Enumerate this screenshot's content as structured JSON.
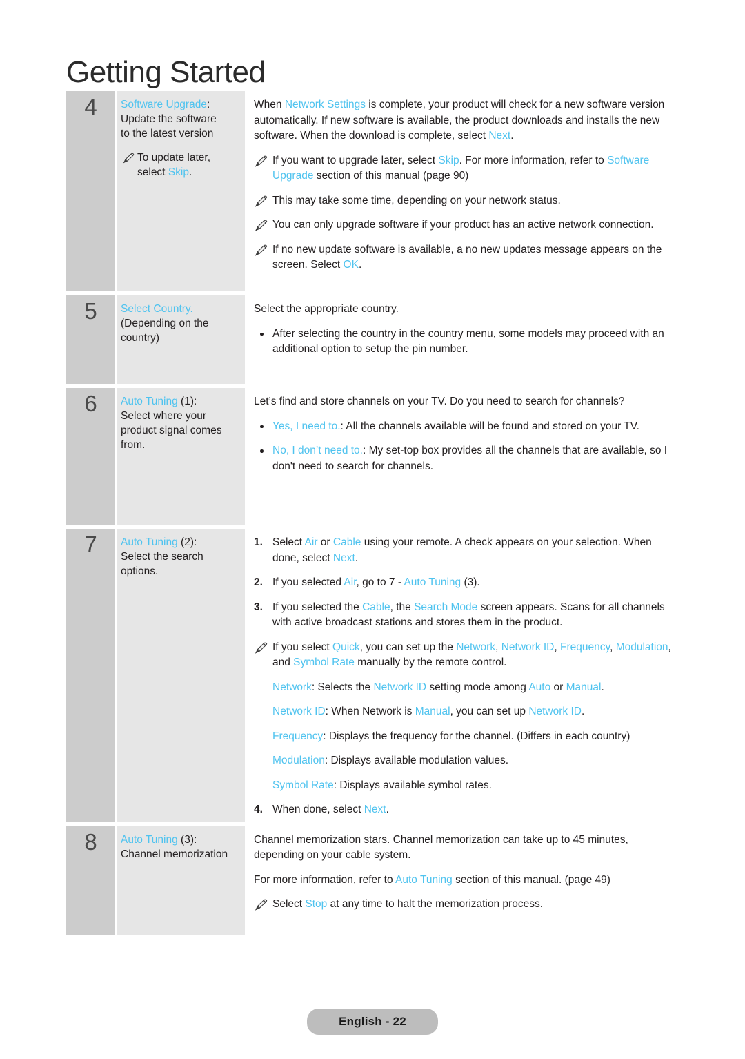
{
  "page": {
    "title": "Getting Started",
    "footer_label": "English - 22",
    "accent_color": "#4fc3ef",
    "number_column_color": "#cccccc",
    "label_column_color": "#e6e6e6"
  },
  "steps": [
    {
      "number": "4",
      "label": {
        "title_accent": "Software Upgrade",
        "title_tail": ":",
        "desc_line1": "Update the software",
        "desc_line2": "to the latest version",
        "note": {
          "icon": "pencil-icon",
          "text_1": "To update later,",
          "text_2": "select ",
          "accent": "Skip",
          "text_3": "."
        }
      },
      "body": [
        {
          "kind": "para",
          "runs": [
            {
              "t": "When "
            },
            {
              "t": "Network Settings",
              "a": true
            },
            {
              "t": " is complete, your product will check for a new software version automatically. If new software is available, the product downloads and installs the new software. When the download is complete, select "
            },
            {
              "t": "Next",
              "a": true
            },
            {
              "t": "."
            }
          ]
        },
        {
          "kind": "note",
          "runs": [
            {
              "t": "If you want to upgrade later, select "
            },
            {
              "t": "Skip",
              "a": true
            },
            {
              "t": ". For more information, refer to "
            },
            {
              "t": "Software Upgrade",
              "a": true
            },
            {
              "t": " section of this manual (page 90)"
            }
          ]
        },
        {
          "kind": "note",
          "runs": [
            {
              "t": "This may take some time, depending on your network status."
            }
          ]
        },
        {
          "kind": "note",
          "runs": [
            {
              "t": "You can only upgrade software if your product has an active network connection."
            }
          ]
        },
        {
          "kind": "note",
          "runs": [
            {
              "t": "If no new update software is available, a no new updates message appears on the screen. Select "
            },
            {
              "t": "OK",
              "a": true
            },
            {
              "t": "."
            }
          ]
        }
      ]
    },
    {
      "number": "5",
      "label": {
        "title_accent": "Select Country.",
        "title_tail": "",
        "desc_line1": "(Depending on the",
        "desc_line2": "country)",
        "note": null
      },
      "body": [
        {
          "kind": "para",
          "runs": [
            {
              "t": "Select the appropriate country."
            }
          ]
        },
        {
          "kind": "bullet",
          "runs": [
            {
              "t": "After selecting the country in the country menu, some models may proceed with an additional option to setup the pin number."
            }
          ]
        }
      ]
    },
    {
      "number": "6",
      "label": {
        "title_accent": "Auto Tuning",
        "title_tail": " (1):",
        "desc_line1": "Select where your",
        "desc_line2": "product signal comes",
        "desc_line3": "from.",
        "note": null
      },
      "body": [
        {
          "kind": "para",
          "runs": [
            {
              "t": "Let’s find and store channels on your TV. Do you need to search for channels?"
            }
          ]
        },
        {
          "kind": "bullet",
          "runs": [
            {
              "t": "Yes, I need to.",
              "a": true
            },
            {
              "t": ": All the channels available will be found and stored on your TV."
            }
          ]
        },
        {
          "kind": "bullet",
          "runs": [
            {
              "t": "No, I don’t need to.",
              "a": true
            },
            {
              "t": ": My set-top box provides all the channels that are available, so I don't need to search for channels."
            }
          ]
        }
      ]
    },
    {
      "number": "7",
      "label": {
        "title_accent": "Auto Tuning",
        "title_tail": " (2):",
        "desc_line1": "Select the search",
        "desc_line2": "options.",
        "note": null
      },
      "body": [
        {
          "kind": "numitem",
          "marker": "1.",
          "runs": [
            {
              "t": "Select "
            },
            {
              "t": "Air",
              "a": true
            },
            {
              "t": " or "
            },
            {
              "t": "Cable",
              "a": true
            },
            {
              "t": " using your remote. A check appears on your selection. When done, select "
            },
            {
              "t": "Next",
              "a": true
            },
            {
              "t": "."
            }
          ]
        },
        {
          "kind": "numitem",
          "marker": "2.",
          "runs": [
            {
              "t": "If you selected "
            },
            {
              "t": "Air",
              "a": true
            },
            {
              "t": ", go to 7 - "
            },
            {
              "t": "Auto Tuning",
              "a": true
            },
            {
              "t": " (3)."
            }
          ]
        },
        {
          "kind": "numitem",
          "marker": "3.",
          "runs": [
            {
              "t": "If you selected the "
            },
            {
              "t": "Cable",
              "a": true
            },
            {
              "t": ", the "
            },
            {
              "t": "Search Mode",
              "a": true
            },
            {
              "t": " screen appears. Scans for all channels with active broadcast stations and stores them in the product."
            }
          ]
        },
        {
          "kind": "note",
          "runs": [
            {
              "t": "If you select "
            },
            {
              "t": "Quick",
              "a": true
            },
            {
              "t": ", you can set up the "
            },
            {
              "t": "Network",
              "a": true
            },
            {
              "t": ", "
            },
            {
              "t": "Network ID",
              "a": true
            },
            {
              "t": ", "
            },
            {
              "t": "Frequency",
              "a": true
            },
            {
              "t": ", "
            },
            {
              "t": "Modulation",
              "a": true
            },
            {
              "t": ", and "
            },
            {
              "t": "Symbol Rate",
              "a": true
            },
            {
              "t": " manually by the remote control."
            }
          ]
        },
        {
          "kind": "defline",
          "runs": [
            {
              "t": "Network",
              "a": true
            },
            {
              "t": ": Selects the "
            },
            {
              "t": "Network ID",
              "a": true
            },
            {
              "t": " setting mode among "
            },
            {
              "t": "Auto",
              "a": true
            },
            {
              "t": " or "
            },
            {
              "t": "Manual",
              "a": true
            },
            {
              "t": "."
            }
          ]
        },
        {
          "kind": "defline",
          "runs": [
            {
              "t": "Network ID",
              "a": true
            },
            {
              "t": ": When Network is "
            },
            {
              "t": "Manual",
              "a": true
            },
            {
              "t": ", you can set up "
            },
            {
              "t": "Network ID",
              "a": true
            },
            {
              "t": "."
            }
          ]
        },
        {
          "kind": "defline",
          "runs": [
            {
              "t": "Frequency",
              "a": true
            },
            {
              "t": ": Displays the frequency for the channel. (Differs in each country)"
            }
          ]
        },
        {
          "kind": "defline",
          "runs": [
            {
              "t": "Modulation",
              "a": true
            },
            {
              "t": ": Displays available modulation values."
            }
          ]
        },
        {
          "kind": "defline",
          "runs": [
            {
              "t": "Symbol Rate",
              "a": true
            },
            {
              "t": ": Displays available symbol rates."
            }
          ]
        },
        {
          "kind": "numitem",
          "marker": "4.",
          "runs": [
            {
              "t": "When done, select "
            },
            {
              "t": "Next",
              "a": true
            },
            {
              "t": "."
            }
          ]
        }
      ]
    },
    {
      "number": "8",
      "label": {
        "title_accent": "Auto Tuning",
        "title_tail": " (3):",
        "desc_line1": "Channel memorization",
        "desc_line2": "",
        "note": null
      },
      "body": [
        {
          "kind": "para",
          "runs": [
            {
              "t": "Channel memorization stars. Channel memorization can take up to 45 minutes, depending on your cable system."
            }
          ]
        },
        {
          "kind": "para",
          "runs": [
            {
              "t": "For more information, refer to "
            },
            {
              "t": "Auto Tuning",
              "a": true
            },
            {
              "t": " section of this manual. (page 49)"
            }
          ]
        },
        {
          "kind": "note",
          "runs": [
            {
              "t": "Select "
            },
            {
              "t": "Stop",
              "a": true
            },
            {
              "t": " at any time to halt the memorization process."
            }
          ]
        }
      ]
    }
  ]
}
